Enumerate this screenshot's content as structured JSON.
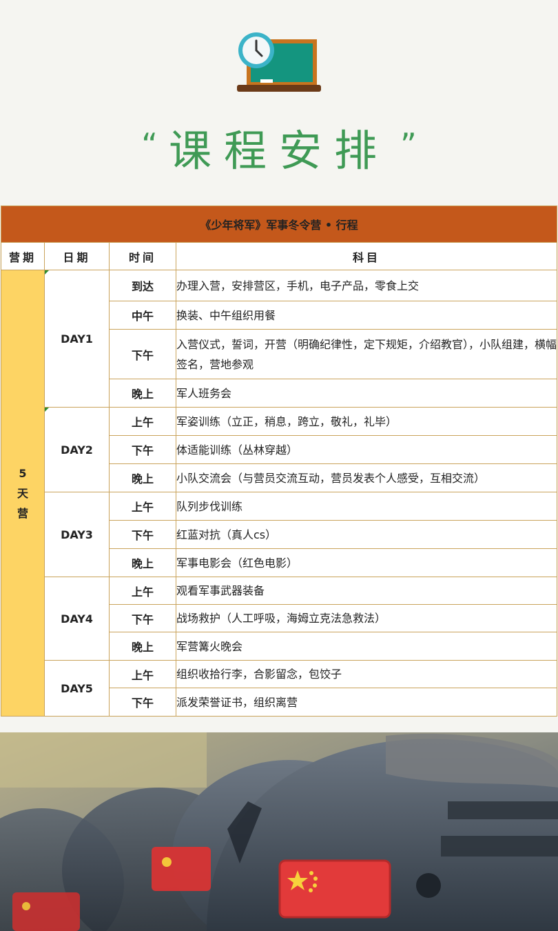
{
  "page": {
    "title": "课程安排",
    "quote_open": "“",
    "quote_close": "”",
    "icon": "blackboard-clock-icon"
  },
  "schedule": {
    "caption": "《少年将军》军事冬令营 • 行程",
    "headers": {
      "camp": "营期",
      "date": "日期",
      "time": "时间",
      "subject": "科目"
    },
    "camp_label": [
      "5",
      "天",
      "营"
    ],
    "days": [
      {
        "label": "DAY1",
        "rows": [
          {
            "time": "到达",
            "subject": "办理入营，安排营区，手机，电子产品，零食上交"
          },
          {
            "time": "中午",
            "subject": "换装、中午组织用餐"
          },
          {
            "time": "下午",
            "subject": "入营仪式，誓词，开营（明确纪律性，定下规矩，介绍教官），小队组建，横幅签名，营地参观"
          },
          {
            "time": "晚上",
            "subject": "军人班务会"
          }
        ]
      },
      {
        "label": "DAY2",
        "rows": [
          {
            "time": "上午",
            "subject": "军姿训练（立正，稍息，跨立，敬礼，礼毕）"
          },
          {
            "time": "下午",
            "subject": "体适能训练（丛林穿越）"
          },
          {
            "time": "晚上",
            "subject": "小队交流会（与营员交流互动，营员发表个人感受，互相交流）"
          }
        ]
      },
      {
        "label": "DAY3",
        "rows": [
          {
            "time": "上午",
            "subject": "队列步伐训练"
          },
          {
            "time": "下午",
            "subject": "红蓝对抗（真人cs）"
          },
          {
            "time": "晚上",
            "subject": "军事电影会（红色电影）"
          }
        ]
      },
      {
        "label": "DAY4",
        "rows": [
          {
            "time": "上午",
            "subject": "观看军事武器装备"
          },
          {
            "time": "下午",
            "subject": "战场救护（人工呼吸，海姆立克法急救法）"
          },
          {
            "time": "晚上",
            "subject": "军营篝火晚会"
          }
        ]
      },
      {
        "label": "DAY5",
        "rows": [
          {
            "time": "上午",
            "subject": "组织收拾行李，合影留念，包饺子"
          },
          {
            "time": "下午",
            "subject": "派发荣誉证书，组织离营"
          }
        ]
      }
    ]
  },
  "colors": {
    "title_green": "#3f9a55",
    "caption_orange": "#c4581b",
    "camp_yellow": "#fdd464",
    "border_gold": "#c9a25a"
  },
  "photo": {
    "icon": "military-helmets-with-flag-patch-photo"
  }
}
